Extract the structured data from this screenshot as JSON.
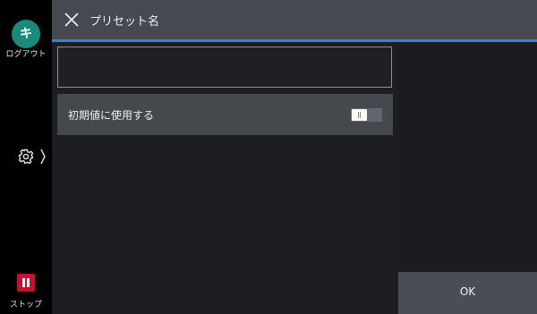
{
  "sidebar": {
    "login_glyph": "キ",
    "login_label": "ログアウト",
    "settings_icon": "gear-icon",
    "stop_label": "ストップ"
  },
  "header": {
    "title": "プリセット名",
    "close_icon": "close-icon"
  },
  "form": {
    "name_value": "",
    "default_toggle_label": "初期値に使用する",
    "default_toggle_on": false
  },
  "actions": {
    "ok_label": "OK"
  },
  "colors": {
    "accent_line": "#3d7fd1",
    "login_circle": "#1a8a7f",
    "stop_red": "#c8102e"
  }
}
